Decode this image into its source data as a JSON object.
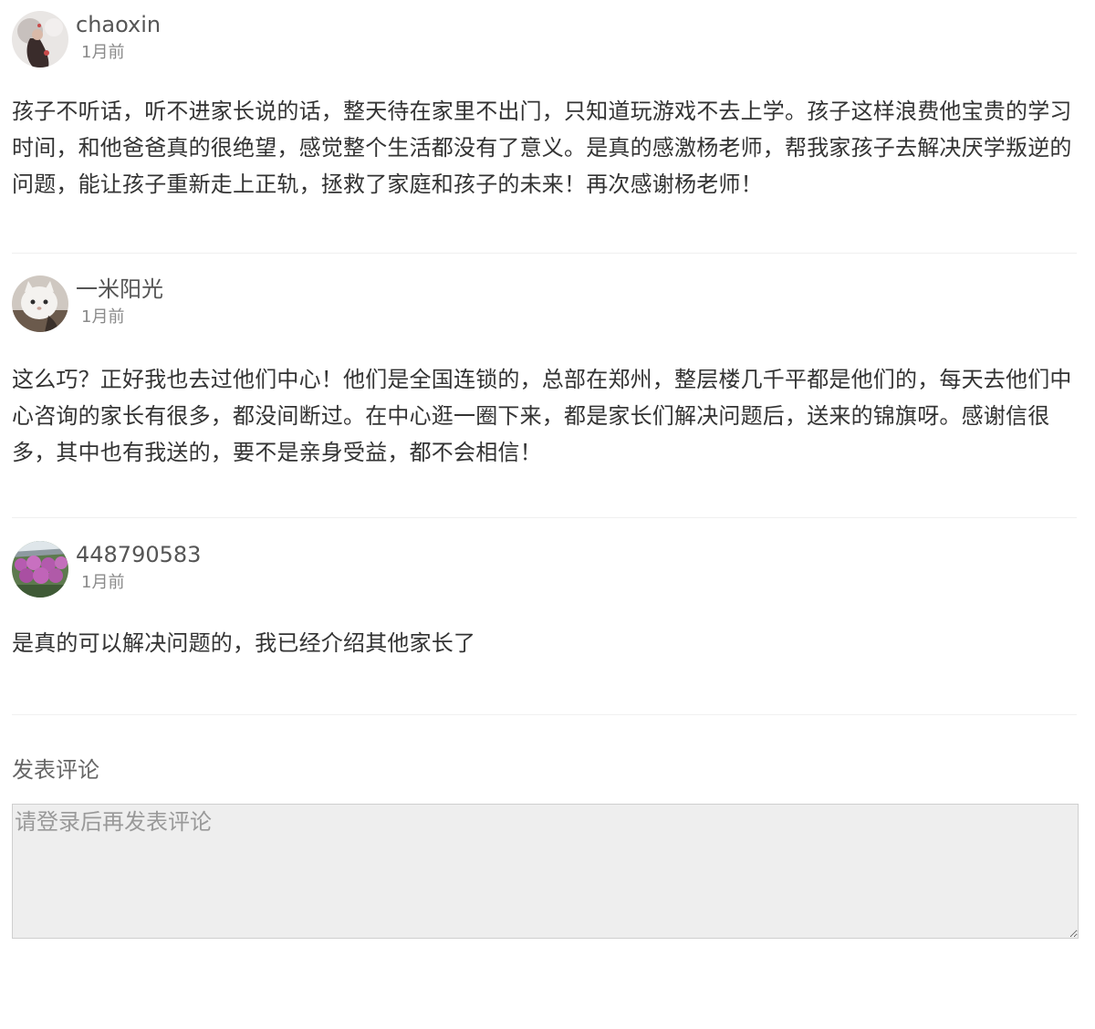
{
  "comments": [
    {
      "username": "chaoxin",
      "time": "1月前",
      "avatar_icon": "avatar-girl-photo",
      "text": "孩子不听话，听不进家长说的话，整天待在家里不出门，只知道玩游戏不去上学。孩子这样浪费他宝贵的学习时间，和他爸爸真的很绝望，感觉整个生活都没有了意义。是真的感激杨老师，帮我家孩子去解决厌学叛逆的问题，能让孩子重新走上正轨，拯救了家庭和孩子的未来！再次感谢杨老师！"
    },
    {
      "username": "一米阳光",
      "time": "1月前",
      "avatar_icon": "avatar-cat-photo",
      "text": "这么巧？正好我也去过他们中心！他们是全国连锁的，总部在郑州，整层楼几千平都是他们的，每天去他们中心咨询的家长有很多，都没间断过。在中心逛一圈下来，都是家长们解决问题后，送来的锦旗呀。感谢信很多，其中也有我送的，要不是亲身受益，都不会相信！"
    },
    {
      "username": "448790583",
      "time": "1月前",
      "avatar_icon": "avatar-flowers-photo",
      "text": "是真的可以解决问题的，我已经介绍其他家长了"
    }
  ],
  "post_comment": {
    "title": "发表评论",
    "placeholder": "请登录后再发表评论"
  }
}
